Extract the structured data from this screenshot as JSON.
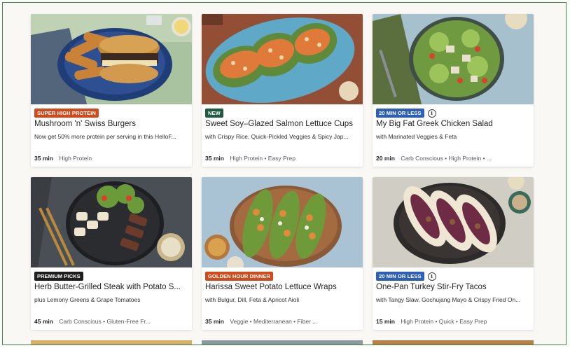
{
  "colors": {
    "badge_orange": "#cf4b1e",
    "badge_green": "#1f5b3f",
    "badge_blue": "#2e5fb8",
    "badge_black": "#1e1e1e"
  },
  "recipes": [
    {
      "badge": "SUPER HIGH PROTEIN",
      "badge_color": "orange",
      "title": "Mushroom 'n' Swiss Burgers",
      "subtitle": "Now get 50% more protein per serving in this HelloF...",
      "time": "35 min",
      "tags": "High Protein"
    },
    {
      "badge": "NEW",
      "badge_color": "green",
      "title": "Sweet Soy–Glazed Salmon Lettuce Cups",
      "subtitle": "with Crispy Rice, Quick-Pickled Veggies & Spicy Jap...",
      "time": "35 min",
      "tags": "High Protein • Easy Prep"
    },
    {
      "badge": "20 MIN OR LESS",
      "badge_color": "blue",
      "info_icon": "ⓘ",
      "title": "My Big Fat Greek Chicken Salad",
      "subtitle": "with Marinated Veggies & Feta",
      "time": "20 min",
      "tags": "Carb Conscious • High Protein • ..."
    },
    {
      "badge": "PREMIUM PICKS",
      "badge_color": "black",
      "title": "Herb Butter-Grilled Steak with Potato S...",
      "subtitle": "plus Lemony Greens & Grape Tomatoes",
      "time": "45 min",
      "tags": "Carb Conscious • Gluten-Free Fr..."
    },
    {
      "badge": "GOLDEN HOUR DINNER",
      "badge_color": "orange",
      "title": "Harissa Sweet Potato Lettuce Wraps",
      "subtitle": "with Bulgur, Dill, Feta & Apricot Aioli",
      "time": "35 min",
      "tags": "Veggie • Mediterranean • Fiber ..."
    },
    {
      "badge": "20 MIN OR LESS",
      "badge_color": "blue",
      "info_icon": "ⓘ",
      "title": "One-Pan Turkey Stir-Fry Tacos",
      "subtitle": "with Tangy Slaw, Gochujang Mayo & Crispy Fried On...",
      "time": "15 min",
      "tags": "High Protein • Quick • Easy Prep"
    }
  ]
}
